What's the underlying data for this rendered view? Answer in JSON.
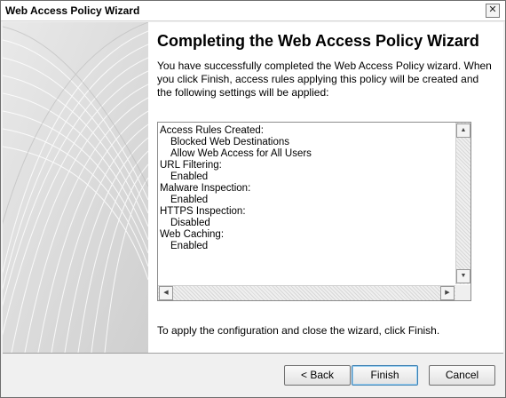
{
  "window": {
    "title": "Web Access Policy Wizard",
    "close_glyph": "✕"
  },
  "page": {
    "heading": "Completing the Web Access Policy Wizard",
    "intro": "You have successfully completed the Web Access Policy wizard. When you click Finish, access rules applying this policy will be created and the following settings will be applied:",
    "footer": "To apply the configuration and close the wizard, click Finish."
  },
  "summary": {
    "lines": [
      {
        "text": "Access Rules Created:",
        "indent": false
      },
      {
        "text": "Blocked Web Destinations",
        "indent": true
      },
      {
        "text": "Allow Web Access for All Users",
        "indent": true
      },
      {
        "text": "URL Filtering:",
        "indent": false
      },
      {
        "text": "Enabled",
        "indent": true
      },
      {
        "text": "Malware Inspection:",
        "indent": false
      },
      {
        "text": "Enabled",
        "indent": true
      },
      {
        "text": "HTTPS Inspection:",
        "indent": false
      },
      {
        "text": "Disabled",
        "indent": true
      },
      {
        "text": "Web Caching:",
        "indent": false
      },
      {
        "text": "Enabled",
        "indent": true
      }
    ]
  },
  "buttons": {
    "back": "< Back",
    "finish": "Finish",
    "cancel": "Cancel"
  }
}
